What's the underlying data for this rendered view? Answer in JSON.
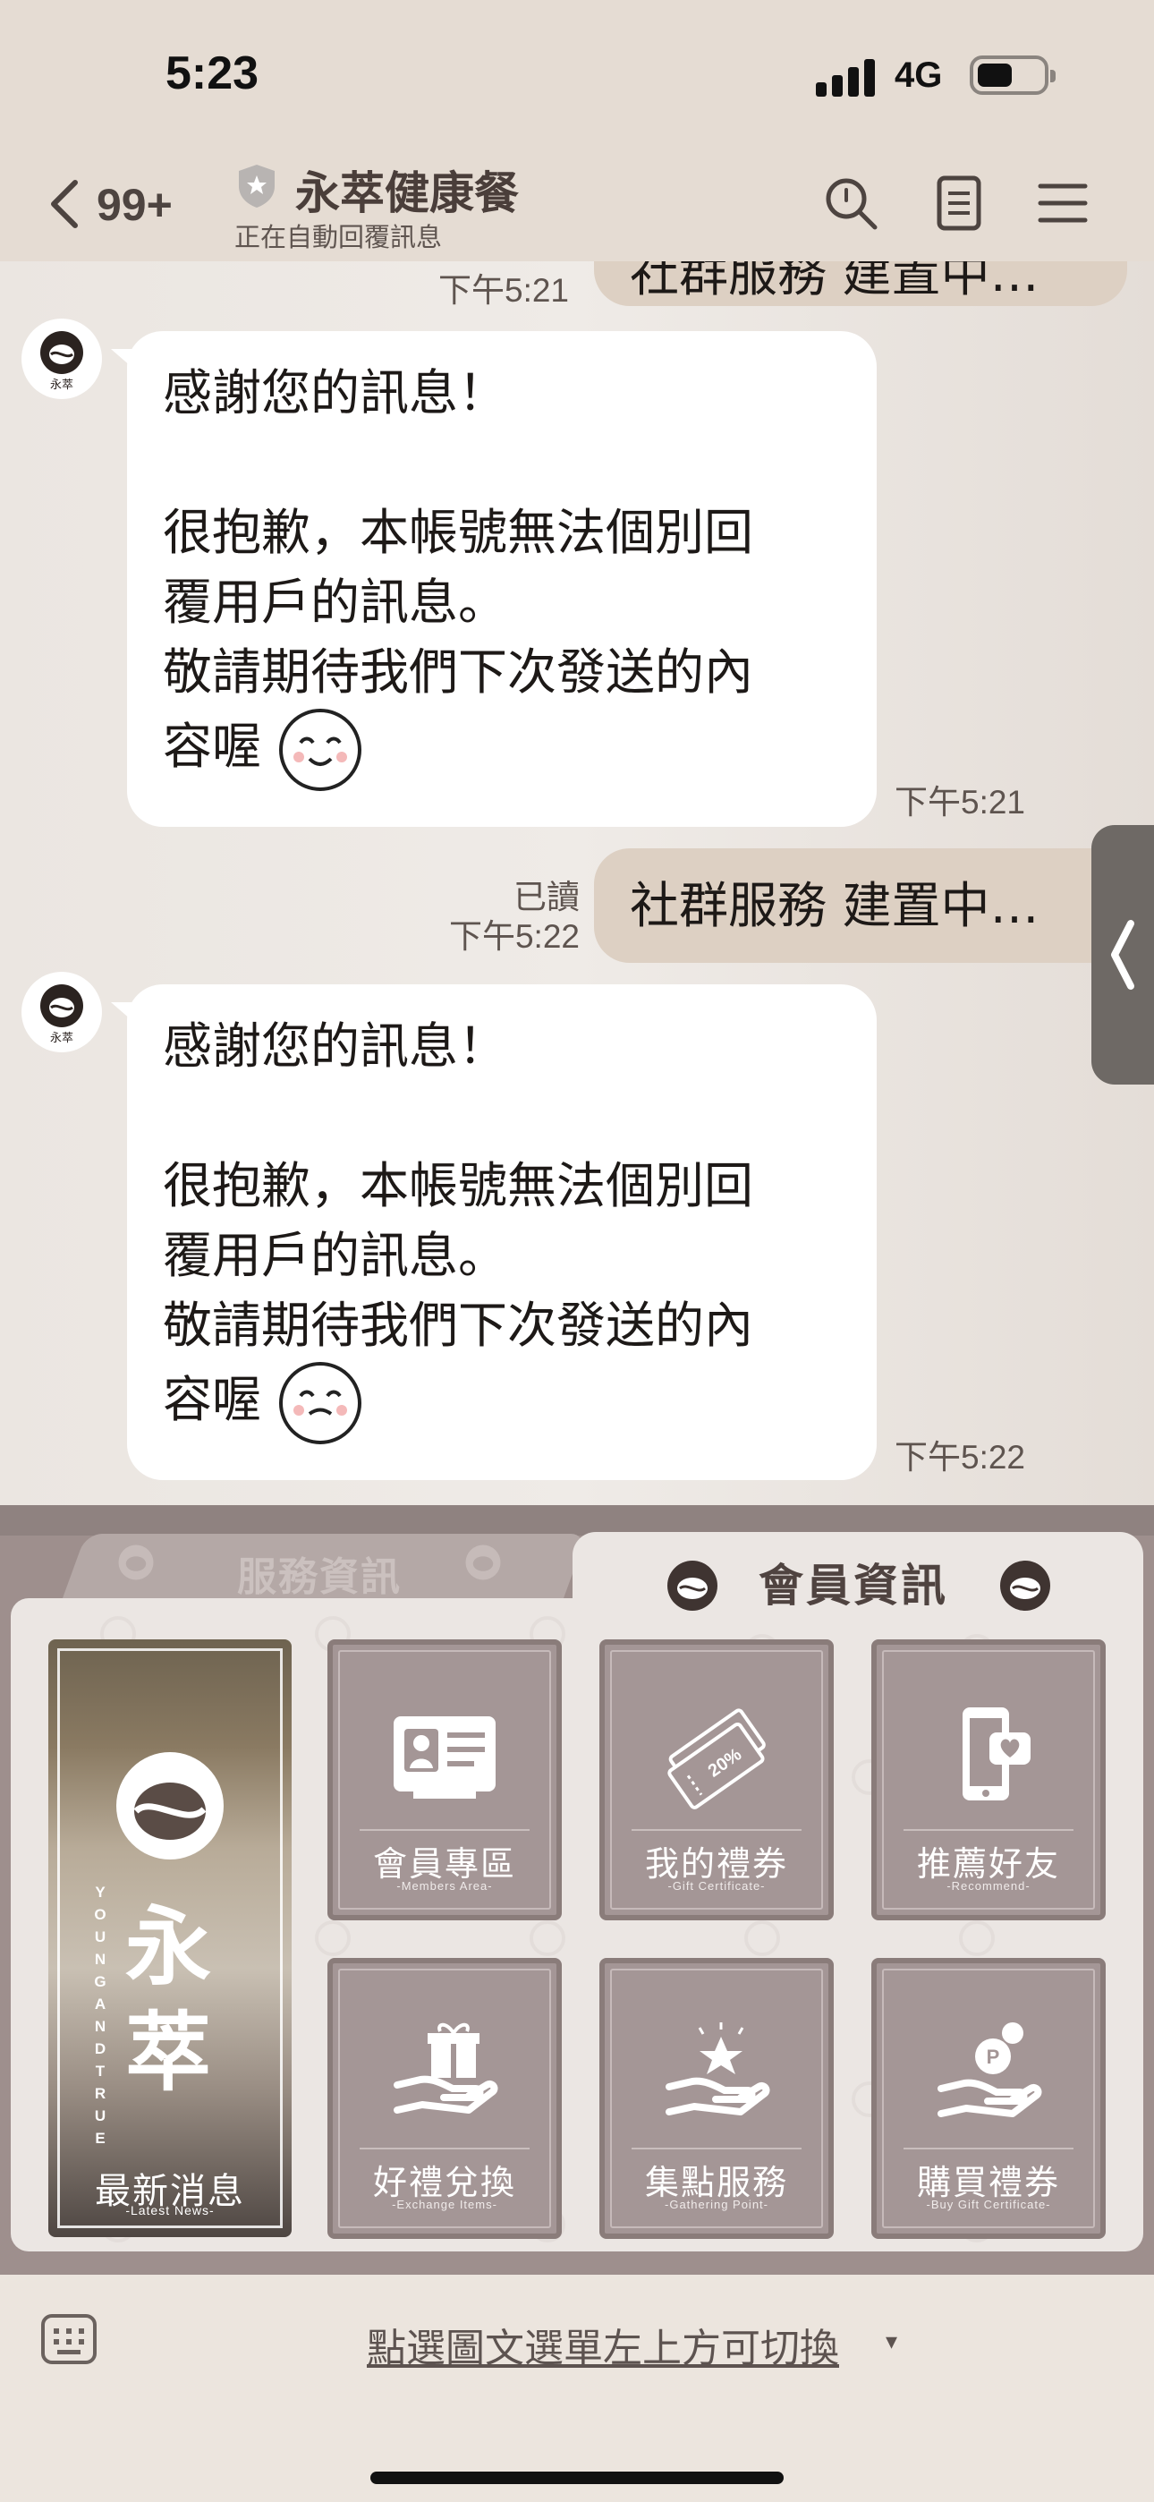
{
  "status_bar": {
    "time": "5:23",
    "network": "4G"
  },
  "header": {
    "back_count": "99+",
    "title": "永萃健康餐",
    "subtitle": "正在自動回覆訊息",
    "icons": [
      "search-icon",
      "note-icon",
      "menu-icon"
    ]
  },
  "chat": {
    "prev_outgoing": {
      "text": "社群服務 建置中…",
      "time": "下午5:21"
    },
    "messages": [
      {
        "direction": "in",
        "lines": [
          "感謝您的訊息！",
          "",
          "很抱歉，本帳號無法個別回",
          "覆用戶的訊息。",
          "敬請期待我們下次發送的內",
          "容喔"
        ],
        "emoji": "smiling-face-icon",
        "time": "下午5:21"
      },
      {
        "direction": "out",
        "text": "社群服務 建置中…",
        "read": "已讀",
        "time": "下午5:22"
      },
      {
        "direction": "in",
        "lines": [
          "感謝您的訊息！",
          "",
          "很抱歉，本帳號無法個別回",
          "覆用戶的訊息。",
          "敬請期待我們下次發送的內",
          "容喔"
        ],
        "emoji": "smiling-face-icon",
        "time": "下午5:22"
      }
    ]
  },
  "rich_menu": {
    "inactive_tab": "服務資訊",
    "active_tab": "會員資訊",
    "news": {
      "brand": [
        "永",
        "萃"
      ],
      "vertical": "YOUNG AND TRUE",
      "label": "最新消息",
      "sub": "-Latest News-"
    },
    "tiles": [
      {
        "label": "會員專區",
        "sub": "-Members Area-",
        "icon": "member-card-icon"
      },
      {
        "label": "我的禮券",
        "sub": "-Gift Certificate-",
        "icon": "coupon-icon",
        "badge": "20%"
      },
      {
        "label": "推薦好友",
        "sub": "-Recommend-",
        "icon": "phone-heart-icon"
      },
      {
        "label": "好禮兌換",
        "sub": "-Exchange Items-",
        "icon": "gift-hand-icon"
      },
      {
        "label": "集點服務",
        "sub": "-Gathering Point-",
        "icon": "star-hand-icon"
      },
      {
        "label": "購買禮券",
        "sub": "-Buy Gift Certificate-",
        "icon": "coin-hand-icon"
      }
    ]
  },
  "bottom_bar": {
    "switch_text": "點選圖文選單左上方可切換",
    "caret": "▾"
  },
  "colors": {
    "outgoing_bubble": "#ddd0c3",
    "incoming_bubble": "#ffffff",
    "menu_tile": "#a49696",
    "header_bg": "#e5dcd3"
  }
}
